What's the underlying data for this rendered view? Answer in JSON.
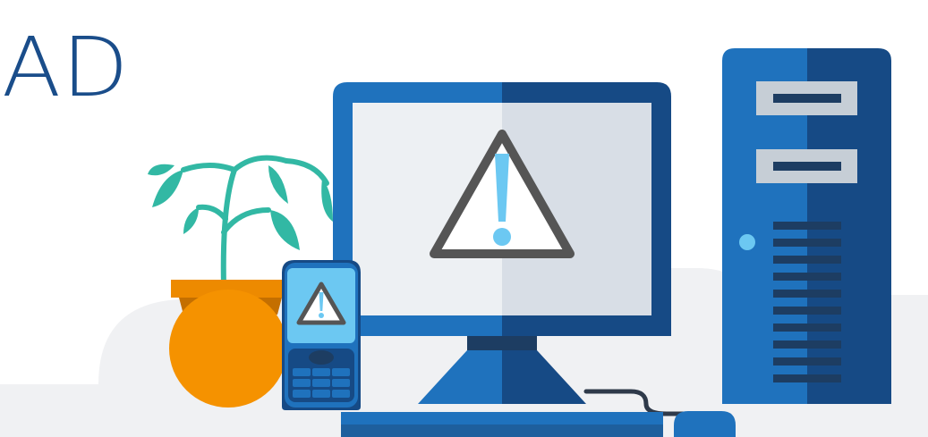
{
  "heading": {
    "text": "AD"
  },
  "colors": {
    "heading": "#1a4d8a",
    "background_blob": "#f0f1f3",
    "blue_light": "#1f72bd",
    "blue_dark": "#164a85",
    "navy": "#1d3d62",
    "screen_left": "#edf0f3",
    "screen_right": "#d8dee6",
    "warning_outline": "#555555",
    "warning_mark": "#6cc8f2",
    "plant_leaf": "#32b8a4",
    "pot": "#f59200",
    "pot_rim": "#ed8a00",
    "cable": "#2f3a4a"
  },
  "icons": {
    "monitor_alert": "warning-triangle-icon",
    "phone_alert": "warning-triangle-icon"
  }
}
